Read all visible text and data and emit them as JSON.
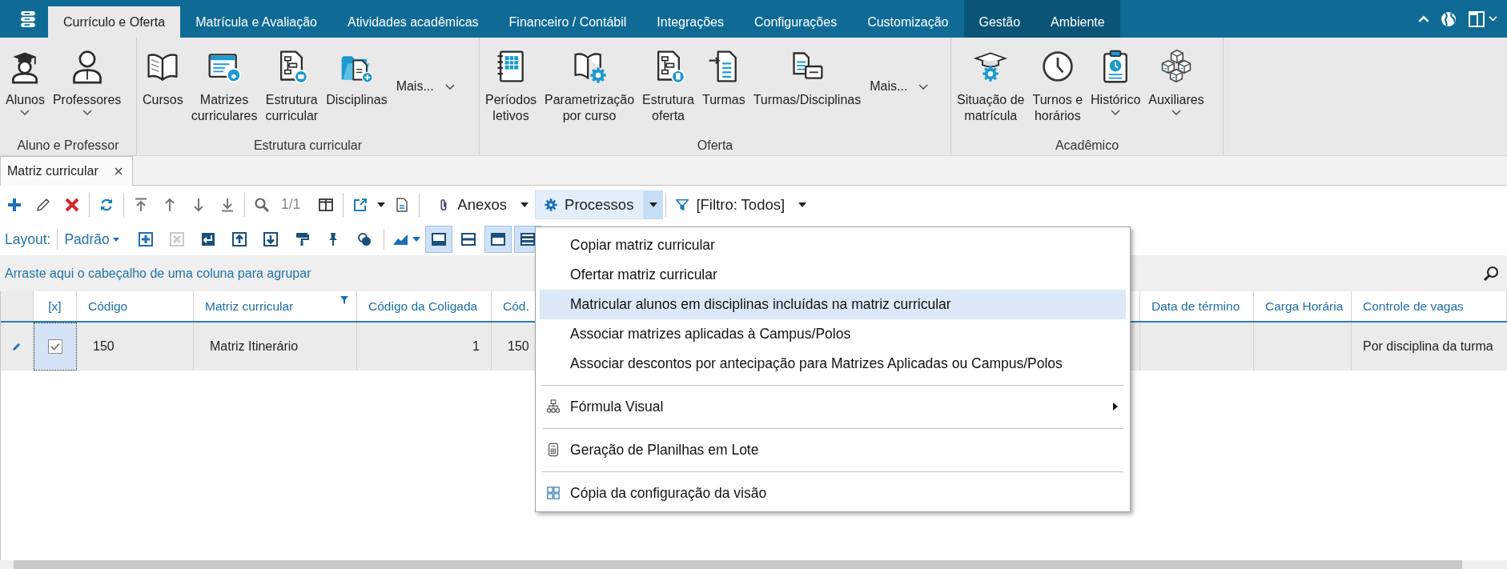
{
  "app_tabs": [
    {
      "label": "Currículo e Oferta",
      "selected": true,
      "contextual": false
    },
    {
      "label": "Matrícula e Avaliação",
      "selected": false,
      "contextual": false
    },
    {
      "label": "Atividades acadêmicas",
      "selected": false,
      "contextual": false
    },
    {
      "label": "Financeiro / Contábil",
      "selected": false,
      "contextual": false
    },
    {
      "label": "Integrações",
      "selected": false,
      "contextual": false
    },
    {
      "label": "Configurações",
      "selected": false,
      "contextual": false
    },
    {
      "label": "Customização",
      "selected": false,
      "contextual": false
    },
    {
      "label": "Gestão",
      "selected": false,
      "contextual": true
    },
    {
      "label": "Ambiente",
      "selected": false,
      "contextual": true
    }
  ],
  "ribbon": {
    "groups": [
      {
        "label": "Aluno e Professor",
        "buttons": [
          {
            "kind": "large",
            "lines": [
              "Alunos"
            ],
            "dropdown": true
          },
          {
            "kind": "large",
            "lines": [
              "Professores"
            ],
            "dropdown": true
          }
        ]
      },
      {
        "label": "Estrutura curricular",
        "buttons": [
          {
            "kind": "large",
            "lines": [
              "Cursos"
            ],
            "dropdown": false
          },
          {
            "kind": "large",
            "lines": [
              "Matrizes",
              "curriculares"
            ],
            "dropdown": false
          },
          {
            "kind": "large",
            "lines": [
              "Estrutura",
              "curricular"
            ],
            "dropdown": false
          },
          {
            "kind": "large",
            "lines": [
              "Disciplinas"
            ],
            "dropdown": false
          },
          {
            "kind": "more",
            "label": "Mais...",
            "dropdown": true
          }
        ]
      },
      {
        "label": "Oferta",
        "buttons": [
          {
            "kind": "large",
            "lines": [
              "Períodos",
              "letivos"
            ],
            "dropdown": false
          },
          {
            "kind": "large",
            "lines": [
              "Parametrização",
              "por curso"
            ],
            "dropdown": false
          },
          {
            "kind": "large",
            "lines": [
              "Estrutura",
              "oferta"
            ],
            "dropdown": false
          },
          {
            "kind": "large",
            "lines": [
              "Turmas"
            ],
            "dropdown": false
          },
          {
            "kind": "large",
            "lines": [
              "Turmas/Disciplinas"
            ],
            "dropdown": false
          },
          {
            "kind": "more",
            "label": "Mais...",
            "dropdown": true
          }
        ]
      },
      {
        "label": "Acadêmico",
        "buttons": [
          {
            "kind": "large",
            "lines": [
              "Situação de",
              "matrícula"
            ],
            "dropdown": false
          },
          {
            "kind": "large",
            "lines": [
              "Turnos e",
              "horários"
            ],
            "dropdown": false
          },
          {
            "kind": "large",
            "lines": [
              "Histórico"
            ],
            "dropdown": true
          },
          {
            "kind": "large",
            "lines": [
              "Auxiliares"
            ],
            "dropdown": true
          }
        ]
      }
    ]
  },
  "document_tabs": [
    {
      "label": "Matriz curricular",
      "selected": true
    }
  ],
  "toolbar": {
    "record_counter": "1/1",
    "attachments": {
      "label": "Anexos"
    },
    "processes": {
      "label": "Processos",
      "expanded": true
    },
    "filter": {
      "label": "[Filtro: Todos]"
    }
  },
  "layout_bar": {
    "label": "Layout:",
    "preset": "Padrão",
    "tools": [
      {
        "disabled": false
      },
      {
        "disabled": true
      },
      {
        "disabled": false
      },
      {
        "disabled": false
      },
      {
        "disabled": false
      },
      {
        "disabled": false
      },
      {
        "disabled": false
      },
      {
        "disabled": false
      }
    ],
    "views": [
      {
        "selected": true
      },
      {
        "selected": false
      },
      {
        "selected": true
      },
      {
        "selected": true
      }
    ]
  },
  "processes_menu": [
    {
      "kind": "item",
      "label": "Copiar matriz curricular",
      "selected": false,
      "submenu": false
    },
    {
      "kind": "item",
      "label": "Ofertar matriz curricular",
      "selected": false,
      "submenu": false
    },
    {
      "kind": "item",
      "label": "Matricular alunos em disciplinas incluídas na matriz curricular",
      "selected": true,
      "submenu": false
    },
    {
      "kind": "item",
      "label": "Associar matrizes aplicadas à Campus/Polos",
      "selected": false,
      "submenu": false
    },
    {
      "kind": "item",
      "label": "Associar descontos por antecipação para Matrizes Aplicadas ou Campus/Polos",
      "selected": false,
      "submenu": false
    },
    {
      "kind": "separator"
    },
    {
      "kind": "item",
      "label": "Fórmula Visual",
      "selected": false,
      "submenu": true
    },
    {
      "kind": "separator"
    },
    {
      "kind": "item",
      "label": "Geração de Planilhas em Lote",
      "selected": false,
      "submenu": false
    },
    {
      "kind": "separator"
    },
    {
      "kind": "item",
      "label": "Cópia da configuração da visão",
      "selected": false,
      "submenu": false
    }
  ],
  "group_panel": {
    "hint": "Arraste aqui o cabeçalho de uma coluna para agrupar"
  },
  "grid": {
    "columns": [
      {
        "label": "[x]",
        "filtered": false
      },
      {
        "label": "Código",
        "filtered": false
      },
      {
        "label": "Matriz curricular",
        "filtered": true
      },
      {
        "label": "Código da Coligada",
        "filtered": false
      },
      {
        "label": "Cód.",
        "filtered": false
      },
      {
        "label": "Data de término",
        "filtered": false
      },
      {
        "label": "Carga Horária",
        "filtered": false
      },
      {
        "label": "Controle de vagas",
        "filtered": false
      }
    ],
    "rows": [
      {
        "selected": true,
        "editing": true,
        "checked": true,
        "cells": [
          "",
          "150",
          "Matriz Itinerário",
          "1",
          "150",
          "",
          "",
          "Por disciplina da turma"
        ]
      }
    ]
  }
}
